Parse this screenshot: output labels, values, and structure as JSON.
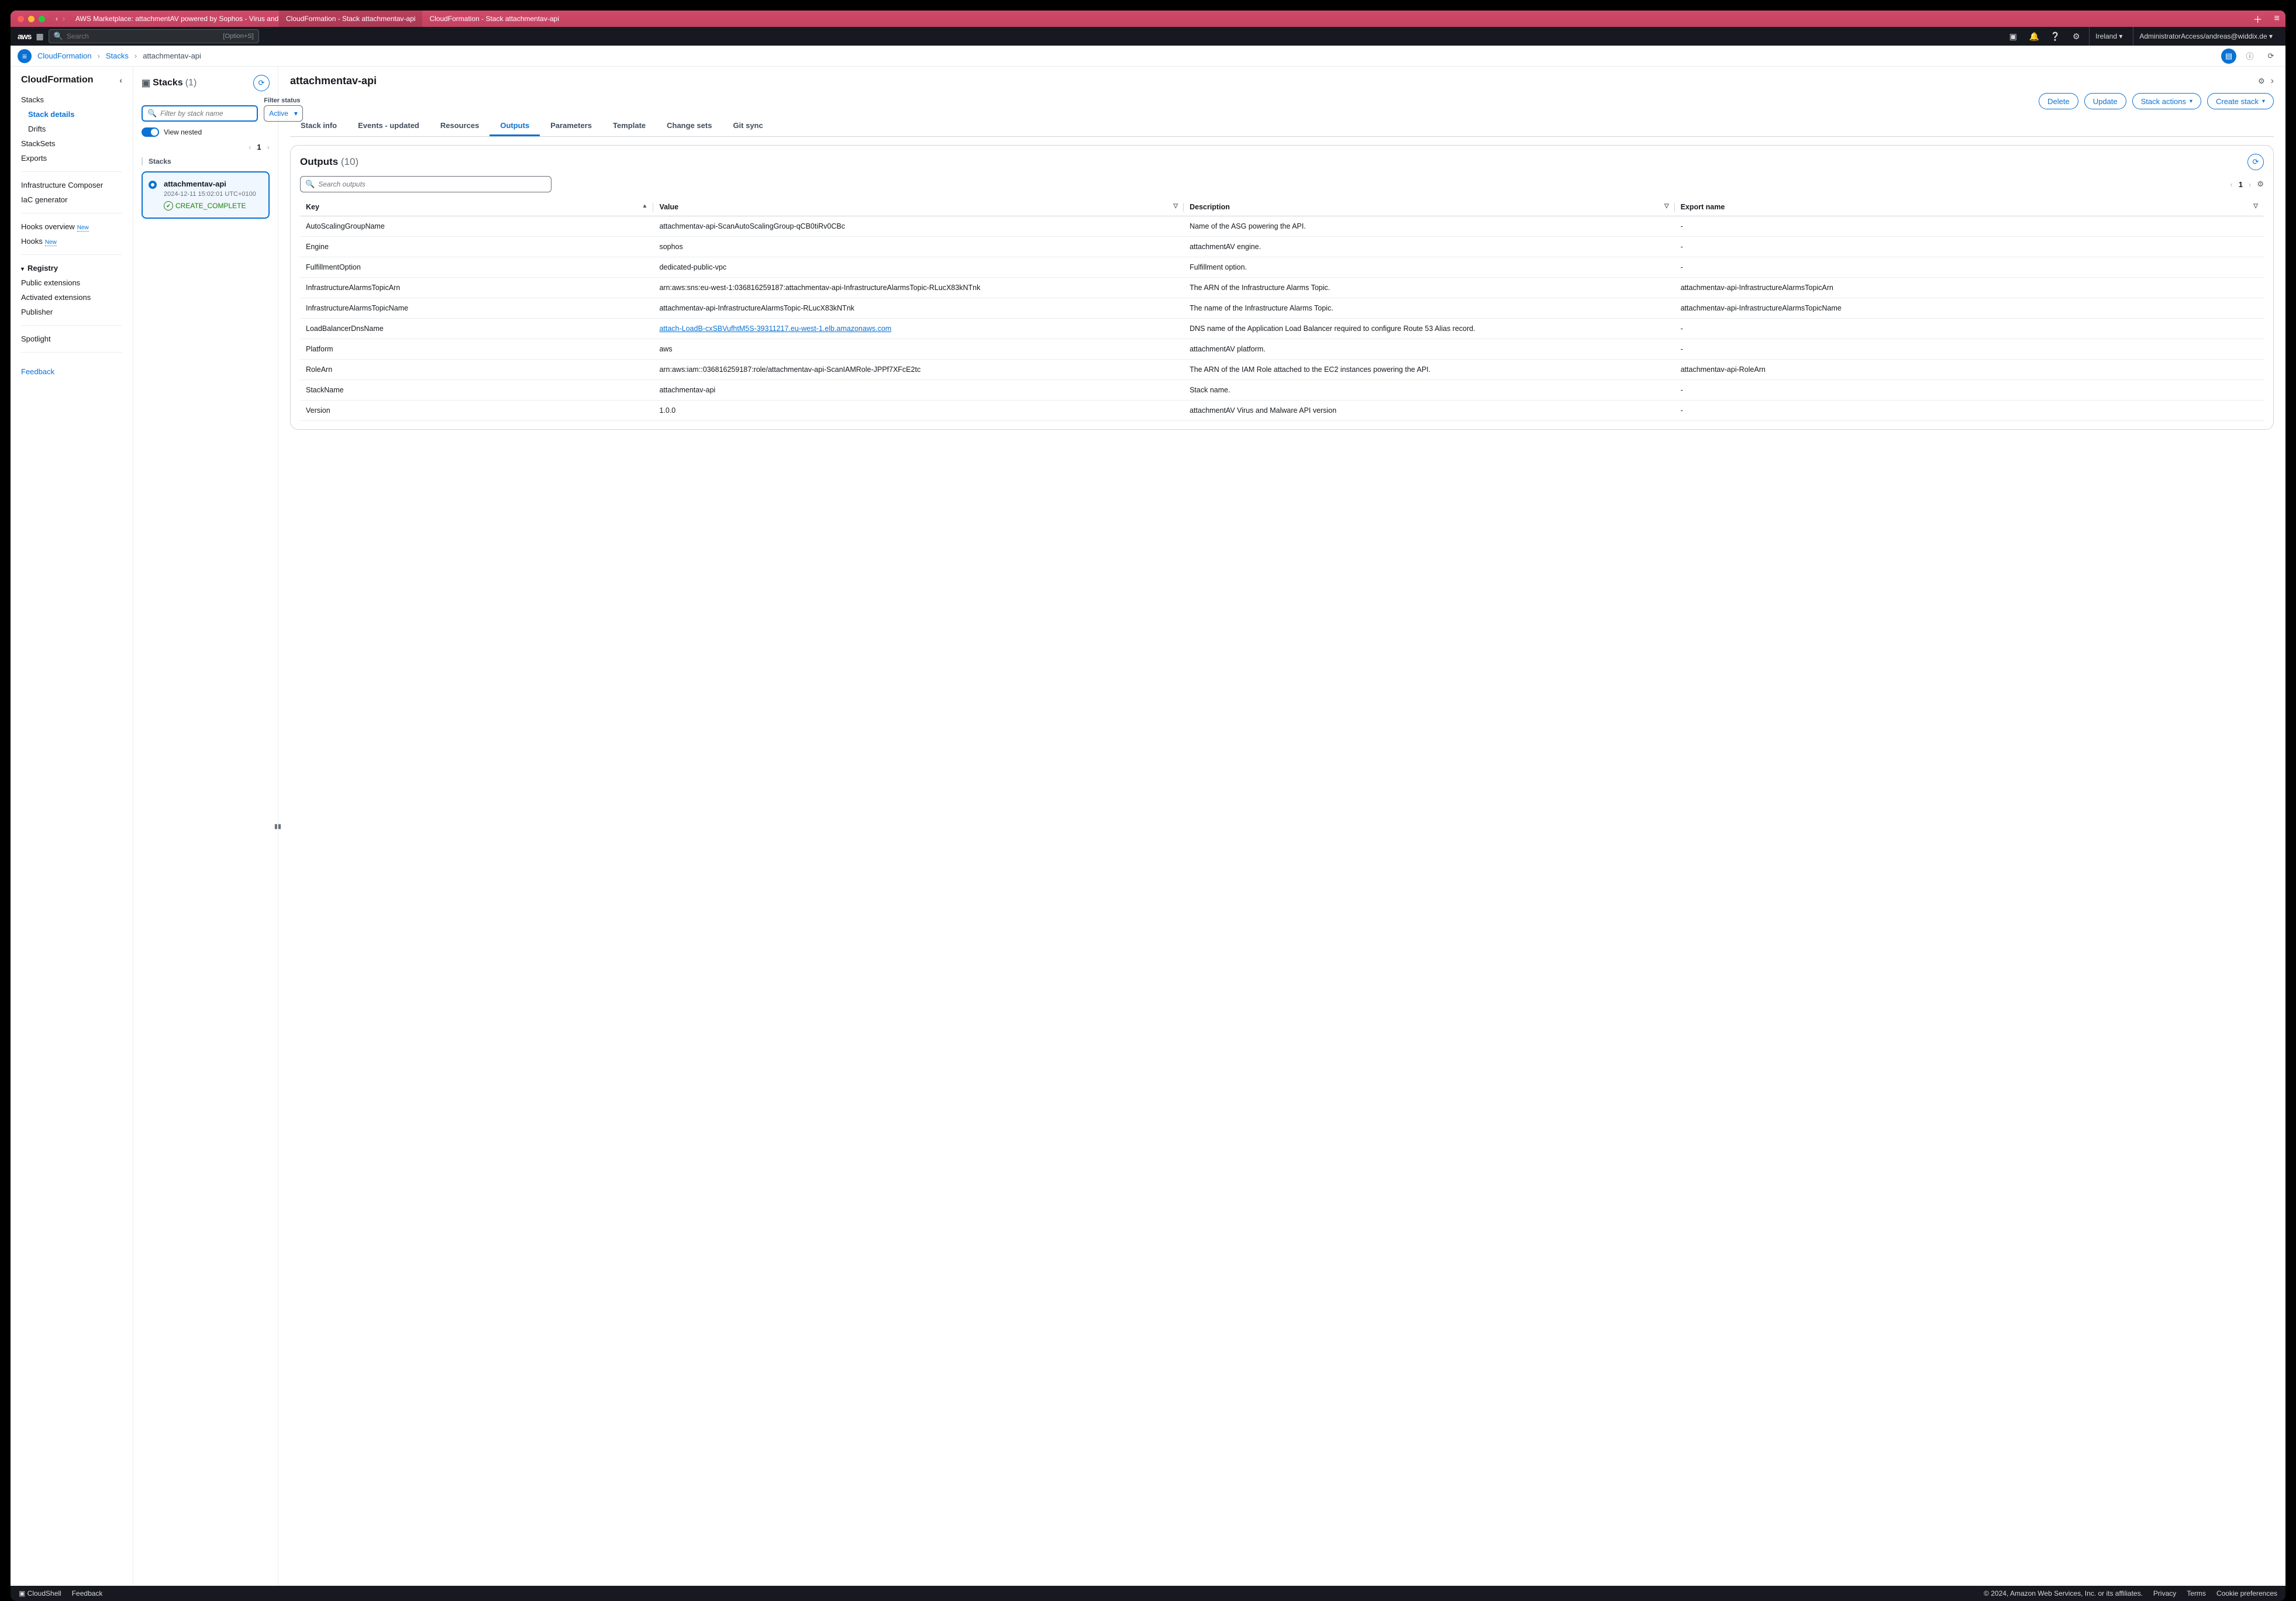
{
  "titlebar": {
    "tab1": "AWS Marketplace: attachmentAV powered by Sophos - Virus and Malware",
    "tab2": "CloudFormation - Stack attachmentav-api",
    "tab3": "CloudFormation - Stack attachmentav-api"
  },
  "aws_top": {
    "search_placeholder": "Search",
    "search_hint": "[Option+S]",
    "region": "Ireland",
    "account": "AdministratorAccess/andreas@widdix.de"
  },
  "breadcrumb": {
    "b1": "CloudFormation",
    "b2": "Stacks",
    "b3": "attachmentav-api"
  },
  "sidenav": {
    "title": "CloudFormation",
    "stacks": "Stacks",
    "stack_details": "Stack details",
    "drifts": "Drifts",
    "stacksets": "StackSets",
    "exports": "Exports",
    "infra_composer": "Infrastructure Composer",
    "iac_generator": "IaC generator",
    "hooks_overview": "Hooks overview",
    "hooks": "Hooks",
    "new_badge": "New",
    "registry": "Registry",
    "public_ext": "Public extensions",
    "activated_ext": "Activated extensions",
    "publisher": "Publisher",
    "spotlight": "Spotlight",
    "feedback": "Feedback"
  },
  "stacks_pane": {
    "title": "Stacks",
    "count": "(1)",
    "filter_placeholder": "Filter by stack name",
    "filter_status_label": "Filter status",
    "status_value": "Active",
    "view_nested": "View nested",
    "page": "1",
    "card": {
      "name": "attachmentav-api",
      "ts": "2024-12-11 15:02:01 UTC+0100",
      "status": "CREATE_COMPLETE"
    },
    "col_label": "Stacks"
  },
  "detail": {
    "title": "attachmentav-api",
    "btn_delete": "Delete",
    "btn_update": "Update",
    "btn_stack_actions": "Stack actions",
    "btn_create_stack": "Create stack",
    "tabs": {
      "info": "Stack info",
      "events": "Events - updated",
      "resources": "Resources",
      "outputs": "Outputs",
      "parameters": "Parameters",
      "template": "Template",
      "changesets": "Change sets",
      "gitsync": "Git sync"
    },
    "outputs_card": {
      "title": "Outputs",
      "count": "(10)",
      "search_placeholder": "Search outputs",
      "page": "1",
      "headers": {
        "key": "Key",
        "value": "Value",
        "desc": "Description",
        "export": "Export name"
      },
      "rows": [
        {
          "key": "AutoScalingGroupName",
          "value": "attachmentav-api-ScanAutoScalingGroup-qCB0tiRv0CBc",
          "desc": "Name of the ASG powering the API.",
          "export": "-"
        },
        {
          "key": "Engine",
          "value": "sophos",
          "desc": "attachmentAV engine.",
          "export": "-"
        },
        {
          "key": "FulfillmentOption",
          "value": "dedicated-public-vpc",
          "desc": "Fulfillment option.",
          "export": "-"
        },
        {
          "key": "InfrastructureAlarmsTopicArn",
          "value": "arn:aws:sns:eu-west-1:036816259187:attachmentav-api-InfrastructureAlarmsTopic-RLucX83kNTnk",
          "desc": "The ARN of the Infrastructure Alarms Topic.",
          "export": "attachmentav-api-InfrastructureAlarmsTopicArn"
        },
        {
          "key": "InfrastructureAlarmsTopicName",
          "value": "attachmentav-api-InfrastructureAlarmsTopic-RLucX83kNTnk",
          "desc": "The name of the Infrastructure Alarms Topic.",
          "export": "attachmentav-api-InfrastructureAlarmsTopicName"
        },
        {
          "key": "LoadBalancerDnsName",
          "value_link": "attach-LoadB-cxSBVufhtM5S-39311217.eu-west-1.elb.amazonaws.com",
          "desc": "DNS name of the Application Load Balancer required to configure Route 53 Alias record.",
          "export": "-"
        },
        {
          "key": "Platform",
          "value": "aws",
          "desc": "attachmentAV platform.",
          "export": "-"
        },
        {
          "key": "RoleArn",
          "value": "arn:aws:iam::036816259187:role/attachmentav-api-ScanIAMRole-JPPf7XFcE2tc",
          "desc": "The ARN of the IAM Role attached to the EC2 instances powering the API.",
          "export": "attachmentav-api-RoleArn"
        },
        {
          "key": "StackName",
          "value": "attachmentav-api",
          "desc": "Stack name.",
          "export": "-"
        },
        {
          "key": "Version",
          "value": "1.0.0",
          "desc": "attachmentAV Virus and Malware API version",
          "export": "-"
        }
      ]
    }
  },
  "footer": {
    "cloudshell": "CloudShell",
    "feedback": "Feedback",
    "copyright": "© 2024, Amazon Web Services, Inc. or its affiliates.",
    "privacy": "Privacy",
    "terms": "Terms",
    "cookies": "Cookie preferences"
  }
}
